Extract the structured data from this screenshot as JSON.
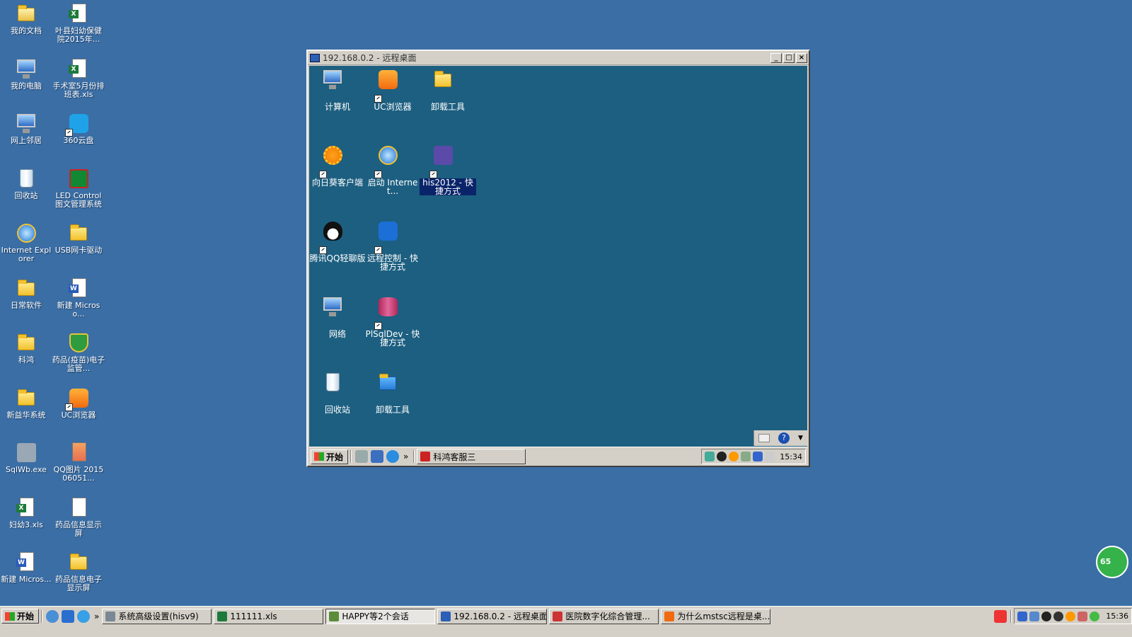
{
  "desktop": {
    "icons_col1": [
      {
        "label": "我的文档",
        "icon": "my-documents-icon"
      },
      {
        "label": "我的电脑",
        "icon": "my-computer-icon"
      },
      {
        "label": "网上邻居",
        "icon": "network-places-icon"
      },
      {
        "label": "回收站",
        "icon": "recycle-bin-icon"
      },
      {
        "label": "Internet Explorer",
        "icon": "internet-explorer-icon"
      },
      {
        "label": "日常软件",
        "icon": "folder-icon"
      },
      {
        "label": "科鸿",
        "icon": "folder-icon"
      },
      {
        "label": "新益华系统",
        "icon": "folder-icon"
      },
      {
        "label": "SqlWb.exe",
        "icon": "tools-icon"
      },
      {
        "label": "妇幼3.xls",
        "icon": "excel-file-icon"
      },
      {
        "label": "新建 Micros...",
        "icon": "word-file-icon"
      }
    ],
    "icons_col2": [
      {
        "label": "叶县妇幼保健院2015年...",
        "icon": "excel-file-icon"
      },
      {
        "label": "手术室5月份排班表.xls",
        "icon": "excel-file-icon"
      },
      {
        "label": "360云盘",
        "icon": "cloud-drive-icon"
      },
      {
        "label": "LED Control 图文管理系统",
        "icon": "led-control-icon"
      },
      {
        "label": "USB网卡驱动",
        "icon": "folder-icon"
      },
      {
        "label": "新建 Microso...",
        "icon": "word-file-icon"
      },
      {
        "label": "药品(疫苗)电子监管...",
        "icon": "shield-icon"
      },
      {
        "label": "UC浏览器",
        "icon": "uc-browser-icon"
      },
      {
        "label": "QQ图片 201506051...",
        "icon": "image-file-icon"
      },
      {
        "label": "药品信息显示屏",
        "icon": "document-icon"
      },
      {
        "label": "药品信息电子显示屏",
        "icon": "folder-icon"
      }
    ]
  },
  "remote_window": {
    "title": "192.168.0.2 - 远程桌面",
    "icons": [
      {
        "label": "计算机",
        "icon": "computer-icon"
      },
      {
        "label": "UC浏览器",
        "icon": "uc-browser-icon"
      },
      {
        "label": "卸载工具",
        "icon": "folder-icon"
      },
      {
        "label": "向日葵客户端",
        "icon": "sunflower-icon"
      },
      {
        "label": "启动 Internet...",
        "icon": "internet-explorer-icon"
      },
      {
        "label": "his2012 - 快捷方式",
        "icon": "his-icon"
      },
      {
        "label": "腾讯QQ轻聊版",
        "icon": "qq-icon"
      },
      {
        "label": "远程控制 - 快捷方式",
        "icon": "teamviewer-icon"
      },
      {
        "label": "网络",
        "icon": "network-icon"
      },
      {
        "label": "PlSqlDev - 快捷方式",
        "icon": "database-icon"
      },
      {
        "label": "回收站",
        "icon": "recycle-bin-icon"
      },
      {
        "label": "卸载工具",
        "icon": "zip-folder-icon"
      }
    ],
    "taskbar": {
      "start_label": "开始",
      "task_label": "科鸿客服三",
      "clock": "15:34"
    }
  },
  "taskbar": {
    "start_label": "开始",
    "chevron": "»",
    "tasks": [
      {
        "label": "系统高级设置(hisv9)",
        "active": false
      },
      {
        "label": "111111.xls",
        "active": false
      },
      {
        "label": "HAPPY等2个会话",
        "active": true
      },
      {
        "label": "192.168.0.2 - 远程桌面",
        "active": false
      },
      {
        "label": "医院数字化综合管理...",
        "active": false
      },
      {
        "label": "为什么mstsc远程是桌...",
        "active": false
      }
    ],
    "clock": "15:36"
  },
  "floating_badge": "65"
}
